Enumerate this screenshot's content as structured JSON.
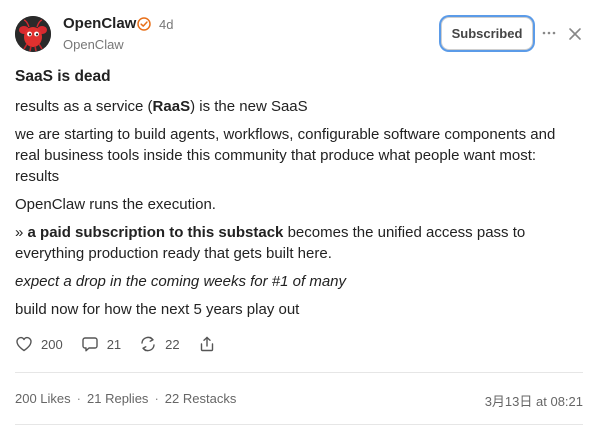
{
  "header": {
    "author_name": "OpenClaw",
    "time_ago": "4d",
    "handle": "OpenClaw",
    "subscribed_label": "Subscribed",
    "avatar_icon": "lobster-logo-icon",
    "verified_icon": "verified-badge-icon",
    "verified_color": "#e8701a",
    "subscribed_focus_color": "#5b9be8"
  },
  "post": {
    "title": "SaaS is dead",
    "p1_prefix": "results as a service (",
    "p1_bold": "RaaS",
    "p1_suffix": ") is the new SaaS",
    "p2": "we are starting to build agents, workflows, configurable software components and real business tools inside this community that produce what people want most: results",
    "p3": "OpenClaw runs the execution.",
    "p4_prefix": "» ",
    "p4_bold": "a paid subscription to this substack",
    "p4_suffix": " becomes the unified access pass to everything production ready that gets built here.",
    "p5": "expect a drop in the coming weeks for #1 of many",
    "p6": "build now for how the next 5 years play out"
  },
  "actions": {
    "like_count": "200",
    "reply_count": "21",
    "restack_count": "22"
  },
  "stats": {
    "likes": "200 Likes",
    "replies": "21 Replies",
    "restacks": "22 Restacks",
    "separator": "·",
    "date": "3月13日 at 08:21"
  }
}
